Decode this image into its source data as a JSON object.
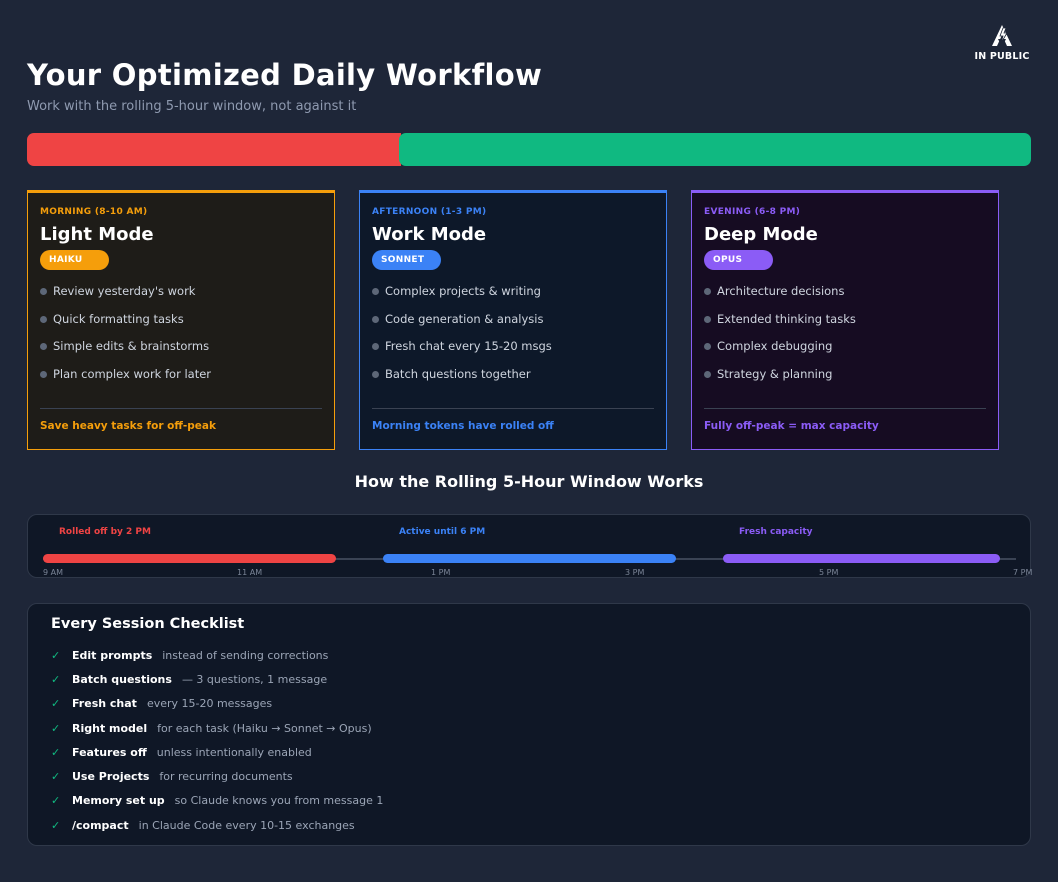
{
  "logo": {
    "text": "IN PUBLIC",
    "icon": "bolt-a-logo-icon"
  },
  "header": {
    "title": "Your Optimized Daily Workflow",
    "subtitle": "Work with the rolling 5-hour window, not against it"
  },
  "colors": {
    "red": "#ef4444",
    "green": "#10b981",
    "orange": "#f59e0b",
    "blue": "#3b82f6",
    "purple": "#8b5cf6"
  },
  "cards": [
    {
      "period": "MORNING (8-10 AM)",
      "title": "Light Mode",
      "model": "HAIKU",
      "items": [
        "Review yesterday's work",
        "Quick formatting tasks",
        "Simple edits & brainstorms",
        "Plan complex work for later"
      ],
      "footer": "Save heavy tasks for off-peak"
    },
    {
      "period": "AFTERNOON (1-3 PM)",
      "title": "Work Mode",
      "model": "SONNET",
      "items": [
        "Complex projects & writing",
        "Code generation & analysis",
        "Fresh chat every 15-20 msgs",
        "Batch questions together"
      ],
      "footer": "Morning tokens have rolled off"
    },
    {
      "period": "EVENING (6-8 PM)",
      "title": "Deep Mode",
      "model": "OPUS",
      "items": [
        "Architecture decisions",
        "Extended thinking tasks",
        "Complex debugging",
        "Strategy & planning"
      ],
      "footer": "Fully off-peak = max capacity"
    }
  ],
  "timeline": {
    "title": "How the Rolling 5-Hour Window Works",
    "segments": [
      {
        "label": "Rolled off by 2 PM"
      },
      {
        "label": "Active until 6 PM"
      },
      {
        "label": "Fresh capacity"
      }
    ],
    "ticks": [
      "9 AM",
      "11 AM",
      "1 PM",
      "3 PM",
      "5 PM",
      "7 PM"
    ]
  },
  "checklist": {
    "title": "Every Session Checklist",
    "check_symbol": "✓",
    "items": [
      {
        "label": "Edit prompts",
        "desc": "instead of sending corrections"
      },
      {
        "label": "Batch questions",
        "desc": "— 3 questions, 1 message"
      },
      {
        "label": "Fresh chat",
        "desc": "every 15-20 messages"
      },
      {
        "label": "Right model",
        "desc": "for each task (Haiku → Sonnet → Opus)"
      },
      {
        "label": "Features off",
        "desc": "unless intentionally enabled"
      },
      {
        "label": "Use Projects",
        "desc": "for recurring documents"
      },
      {
        "label": "Memory set up",
        "desc": "so Claude knows you from message 1"
      },
      {
        "label": "/compact",
        "desc": "in Claude Code every 10-15 exchanges"
      }
    ]
  }
}
